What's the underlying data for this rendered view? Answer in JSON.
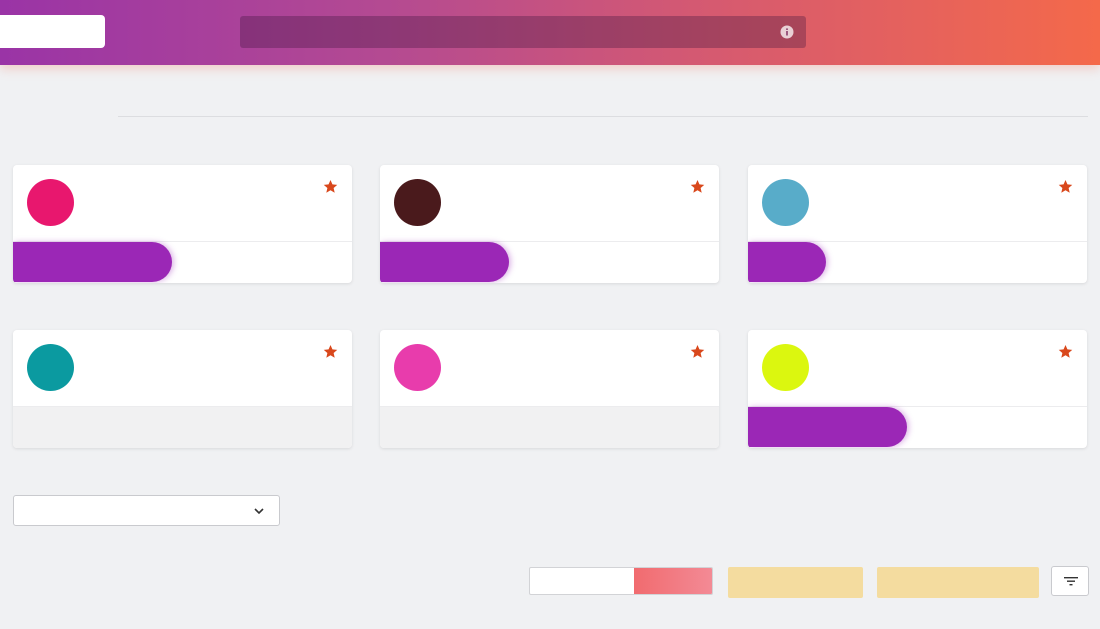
{
  "header": {
    "search": {
      "value": ""
    },
    "icons": {
      "info": "info-icon"
    }
  },
  "colors": {
    "header_gradient": [
      "#9a34a6",
      "#f4694a"
    ],
    "accent_bar": "#9b27b6",
    "star": "#d9481c",
    "segment_active": "#f16b6f",
    "action_button": "#f4dc9f"
  },
  "cards": [
    {
      "avatar_color": "#e8176e",
      "starred": true,
      "icon": "star-icon",
      "progress": 0.47
    },
    {
      "avatar_color": "#4a1a1c",
      "starred": true,
      "icon": "star-icon",
      "progress": 0.38
    },
    {
      "avatar_color": "#58acc9",
      "starred": true,
      "icon": "star-icon",
      "progress": 0.23
    },
    {
      "avatar_color": "#0b9aa0",
      "starred": true,
      "icon": "star-icon",
      "progress": null
    },
    {
      "avatar_color": "#e83cac",
      "starred": true,
      "icon": "star-icon",
      "progress": null
    },
    {
      "avatar_color": "#dbf70f",
      "starred": true,
      "icon": "star-icon",
      "progress": 0.47
    }
  ],
  "controls": {
    "dropdown": {
      "selected": "",
      "icon": "chevron-down-icon"
    },
    "segmented": {
      "options": [
        "",
        ""
      ],
      "active_index": 1
    },
    "buttons": [
      "",
      ""
    ],
    "filter": {
      "icon": "filter-icon"
    }
  }
}
